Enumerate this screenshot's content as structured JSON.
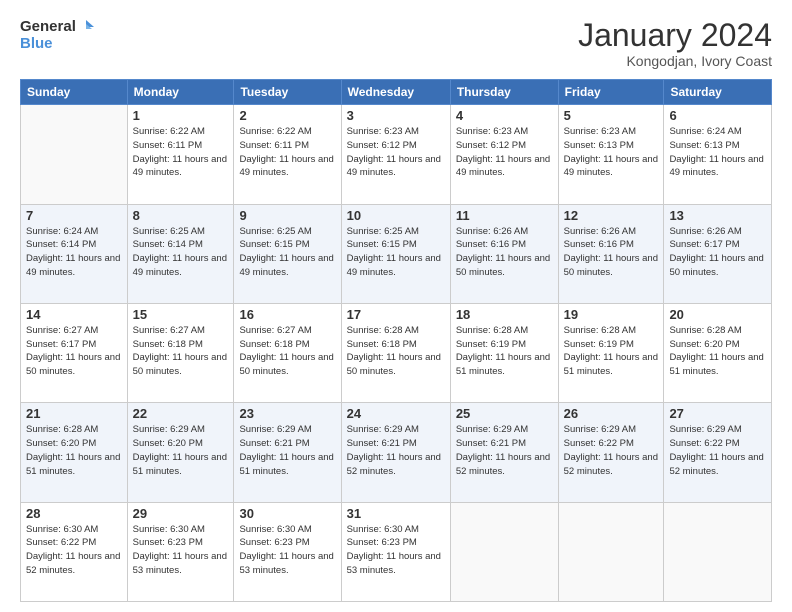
{
  "header": {
    "logo_general": "General",
    "logo_blue": "Blue",
    "month_title": "January 2024",
    "location": "Kongodjan, Ivory Coast"
  },
  "weekdays": [
    "Sunday",
    "Monday",
    "Tuesday",
    "Wednesday",
    "Thursday",
    "Friday",
    "Saturday"
  ],
  "weeks": [
    [
      {
        "day": "",
        "sunrise": "",
        "sunset": "",
        "daylight": ""
      },
      {
        "day": "1",
        "sunrise": "Sunrise: 6:22 AM",
        "sunset": "Sunset: 6:11 PM",
        "daylight": "Daylight: 11 hours and 49 minutes."
      },
      {
        "day": "2",
        "sunrise": "Sunrise: 6:22 AM",
        "sunset": "Sunset: 6:11 PM",
        "daylight": "Daylight: 11 hours and 49 minutes."
      },
      {
        "day": "3",
        "sunrise": "Sunrise: 6:23 AM",
        "sunset": "Sunset: 6:12 PM",
        "daylight": "Daylight: 11 hours and 49 minutes."
      },
      {
        "day": "4",
        "sunrise": "Sunrise: 6:23 AM",
        "sunset": "Sunset: 6:12 PM",
        "daylight": "Daylight: 11 hours and 49 minutes."
      },
      {
        "day": "5",
        "sunrise": "Sunrise: 6:23 AM",
        "sunset": "Sunset: 6:13 PM",
        "daylight": "Daylight: 11 hours and 49 minutes."
      },
      {
        "day": "6",
        "sunrise": "Sunrise: 6:24 AM",
        "sunset": "Sunset: 6:13 PM",
        "daylight": "Daylight: 11 hours and 49 minutes."
      }
    ],
    [
      {
        "day": "7",
        "sunrise": "Sunrise: 6:24 AM",
        "sunset": "Sunset: 6:14 PM",
        "daylight": "Daylight: 11 hours and 49 minutes."
      },
      {
        "day": "8",
        "sunrise": "Sunrise: 6:25 AM",
        "sunset": "Sunset: 6:14 PM",
        "daylight": "Daylight: 11 hours and 49 minutes."
      },
      {
        "day": "9",
        "sunrise": "Sunrise: 6:25 AM",
        "sunset": "Sunset: 6:15 PM",
        "daylight": "Daylight: 11 hours and 49 minutes."
      },
      {
        "day": "10",
        "sunrise": "Sunrise: 6:25 AM",
        "sunset": "Sunset: 6:15 PM",
        "daylight": "Daylight: 11 hours and 49 minutes."
      },
      {
        "day": "11",
        "sunrise": "Sunrise: 6:26 AM",
        "sunset": "Sunset: 6:16 PM",
        "daylight": "Daylight: 11 hours and 50 minutes."
      },
      {
        "day": "12",
        "sunrise": "Sunrise: 6:26 AM",
        "sunset": "Sunset: 6:16 PM",
        "daylight": "Daylight: 11 hours and 50 minutes."
      },
      {
        "day": "13",
        "sunrise": "Sunrise: 6:26 AM",
        "sunset": "Sunset: 6:17 PM",
        "daylight": "Daylight: 11 hours and 50 minutes."
      }
    ],
    [
      {
        "day": "14",
        "sunrise": "Sunrise: 6:27 AM",
        "sunset": "Sunset: 6:17 PM",
        "daylight": "Daylight: 11 hours and 50 minutes."
      },
      {
        "day": "15",
        "sunrise": "Sunrise: 6:27 AM",
        "sunset": "Sunset: 6:18 PM",
        "daylight": "Daylight: 11 hours and 50 minutes."
      },
      {
        "day": "16",
        "sunrise": "Sunrise: 6:27 AM",
        "sunset": "Sunset: 6:18 PM",
        "daylight": "Daylight: 11 hours and 50 minutes."
      },
      {
        "day": "17",
        "sunrise": "Sunrise: 6:28 AM",
        "sunset": "Sunset: 6:18 PM",
        "daylight": "Daylight: 11 hours and 50 minutes."
      },
      {
        "day": "18",
        "sunrise": "Sunrise: 6:28 AM",
        "sunset": "Sunset: 6:19 PM",
        "daylight": "Daylight: 11 hours and 51 minutes."
      },
      {
        "day": "19",
        "sunrise": "Sunrise: 6:28 AM",
        "sunset": "Sunset: 6:19 PM",
        "daylight": "Daylight: 11 hours and 51 minutes."
      },
      {
        "day": "20",
        "sunrise": "Sunrise: 6:28 AM",
        "sunset": "Sunset: 6:20 PM",
        "daylight": "Daylight: 11 hours and 51 minutes."
      }
    ],
    [
      {
        "day": "21",
        "sunrise": "Sunrise: 6:28 AM",
        "sunset": "Sunset: 6:20 PM",
        "daylight": "Daylight: 11 hours and 51 minutes."
      },
      {
        "day": "22",
        "sunrise": "Sunrise: 6:29 AM",
        "sunset": "Sunset: 6:20 PM",
        "daylight": "Daylight: 11 hours and 51 minutes."
      },
      {
        "day": "23",
        "sunrise": "Sunrise: 6:29 AM",
        "sunset": "Sunset: 6:21 PM",
        "daylight": "Daylight: 11 hours and 51 minutes."
      },
      {
        "day": "24",
        "sunrise": "Sunrise: 6:29 AM",
        "sunset": "Sunset: 6:21 PM",
        "daylight": "Daylight: 11 hours and 52 minutes."
      },
      {
        "day": "25",
        "sunrise": "Sunrise: 6:29 AM",
        "sunset": "Sunset: 6:21 PM",
        "daylight": "Daylight: 11 hours and 52 minutes."
      },
      {
        "day": "26",
        "sunrise": "Sunrise: 6:29 AM",
        "sunset": "Sunset: 6:22 PM",
        "daylight": "Daylight: 11 hours and 52 minutes."
      },
      {
        "day": "27",
        "sunrise": "Sunrise: 6:29 AM",
        "sunset": "Sunset: 6:22 PM",
        "daylight": "Daylight: 11 hours and 52 minutes."
      }
    ],
    [
      {
        "day": "28",
        "sunrise": "Sunrise: 6:30 AM",
        "sunset": "Sunset: 6:22 PM",
        "daylight": "Daylight: 11 hours and 52 minutes."
      },
      {
        "day": "29",
        "sunrise": "Sunrise: 6:30 AM",
        "sunset": "Sunset: 6:23 PM",
        "daylight": "Daylight: 11 hours and 53 minutes."
      },
      {
        "day": "30",
        "sunrise": "Sunrise: 6:30 AM",
        "sunset": "Sunset: 6:23 PM",
        "daylight": "Daylight: 11 hours and 53 minutes."
      },
      {
        "day": "31",
        "sunrise": "Sunrise: 6:30 AM",
        "sunset": "Sunset: 6:23 PM",
        "daylight": "Daylight: 11 hours and 53 minutes."
      },
      {
        "day": "",
        "sunrise": "",
        "sunset": "",
        "daylight": ""
      },
      {
        "day": "",
        "sunrise": "",
        "sunset": "",
        "daylight": ""
      },
      {
        "day": "",
        "sunrise": "",
        "sunset": "",
        "daylight": ""
      }
    ]
  ]
}
